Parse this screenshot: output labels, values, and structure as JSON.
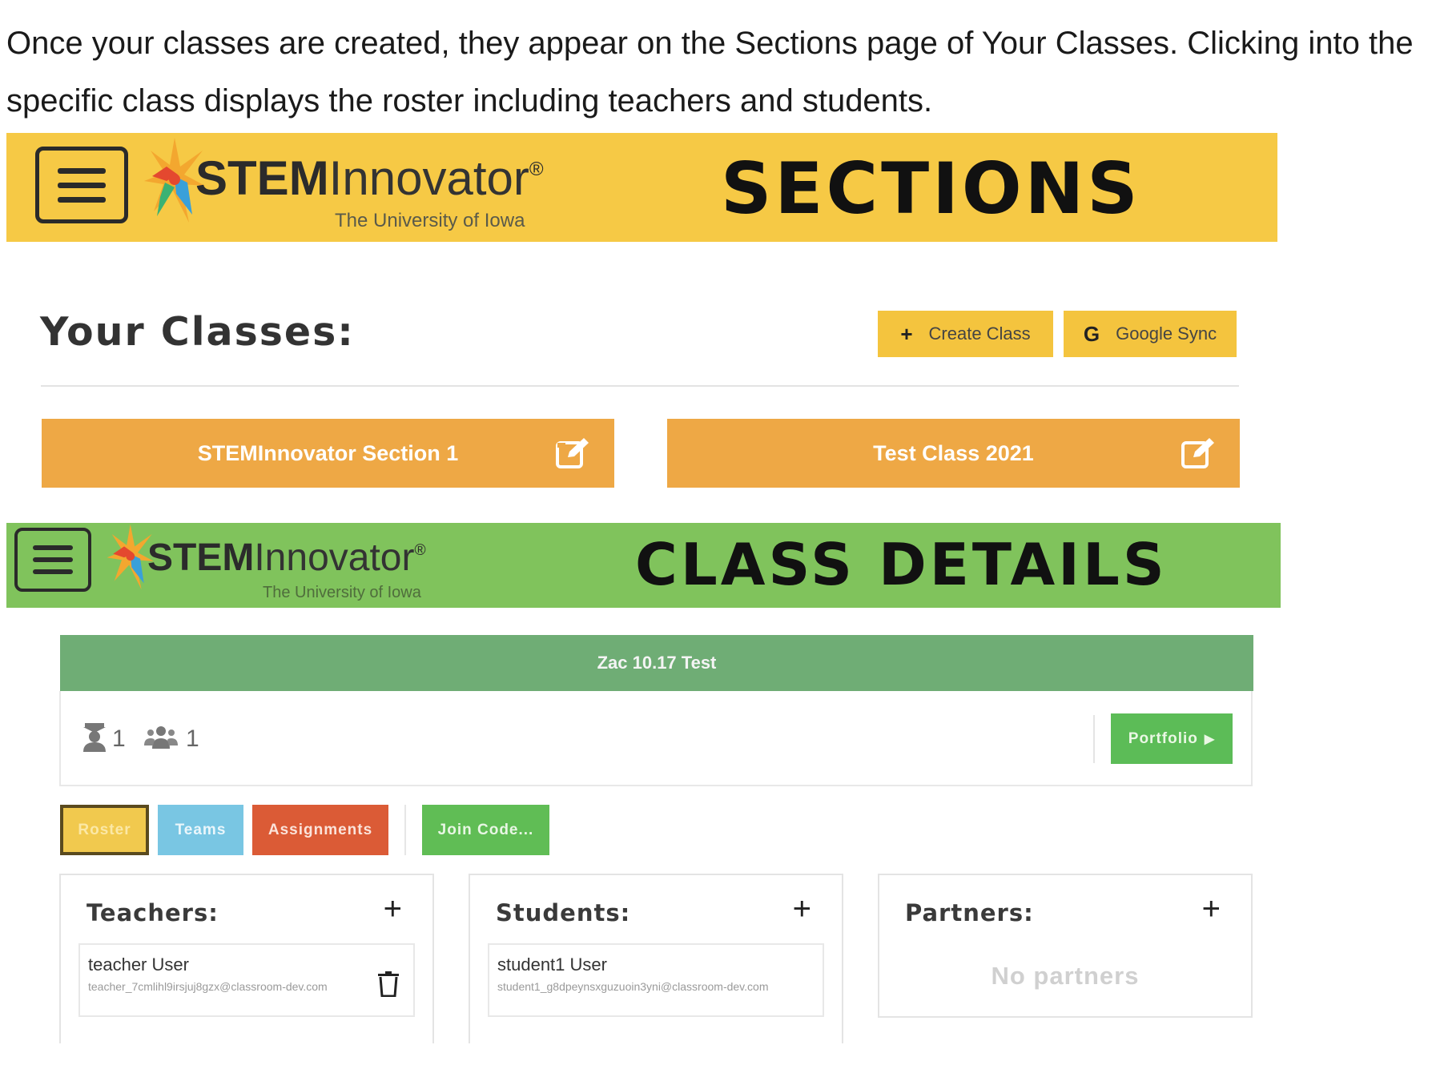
{
  "intro": "Once your classes are created, they appear on the Sections page of Your Classes. Clicking into the specific class displays the roster including teachers and students.",
  "logo": {
    "word_bold": "STEM",
    "word_light": "Innovator",
    "registered": "®",
    "subtitle": "The University of Iowa"
  },
  "sections_banner": {
    "title": "SECTIONS",
    "color": "#f6c945"
  },
  "your_classes": {
    "title": "Your Classes:",
    "create_icon": "plus-icon",
    "create_label": "Create Class",
    "google_icon": "google-g-icon",
    "google_label": "Google Sync",
    "classes": [
      {
        "name": "STEMInnovator Section 1",
        "icon": "edit-icon"
      },
      {
        "name": "Test Class 2021",
        "icon": "edit-icon"
      }
    ]
  },
  "details_banner": {
    "title": "CLASS DETAILS",
    "color": "#80c35c"
  },
  "class_details": {
    "class_name": "Zac 10.17 Test",
    "teacher_count": "1",
    "student_count": "1",
    "portfolio_label": "Portfolio",
    "tabs": [
      {
        "label": "Roster",
        "color": "#f1c94e",
        "active": true
      },
      {
        "label": "Teams",
        "color": "#79c6e3"
      },
      {
        "label": "Assignments",
        "color": "#db5b36"
      },
      {
        "label": "Join Code...",
        "color": "#60bd55"
      }
    ],
    "teachers": {
      "title": "Teachers:",
      "add": "+",
      "members": [
        {
          "name": "teacher User",
          "email": "teacher_7cmlihl9irsjuj8gzx@classroom-dev.com"
        }
      ]
    },
    "students": {
      "title": "Students:",
      "add": "+",
      "members": [
        {
          "name": "student1 User",
          "email": "student1_g8dpeynsxguzuoin3yni@classroom-dev.com"
        }
      ]
    },
    "partners": {
      "title": "Partners:",
      "add": "+",
      "empty": "No partners"
    }
  }
}
